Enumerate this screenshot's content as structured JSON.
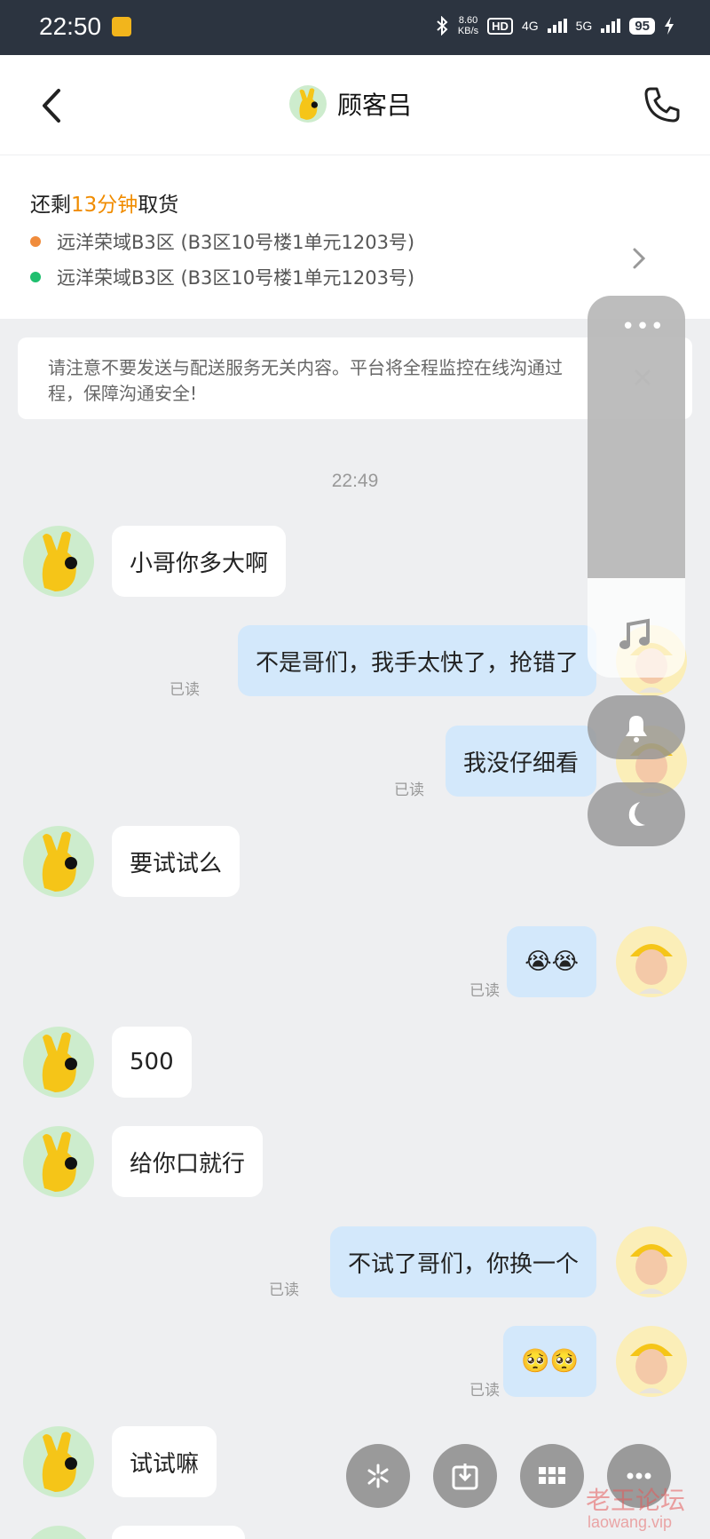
{
  "status_bar": {
    "time": "22:50",
    "net_speed_value": "8.60",
    "net_speed_unit": "KB/s",
    "hd_label": "HD",
    "sim1_label": "4G",
    "sim2_label": "5G",
    "battery": "95"
  },
  "header": {
    "title": "顾客吕"
  },
  "order": {
    "prefix": "还剩",
    "time_left": "13分钟",
    "suffix": "取货",
    "pickup_address": "远洋荣域B3区 (B3区10号楼1单元1203号)",
    "delivery_address": "远洋荣域B3区 (B3区10号楼1单元1203号)",
    "pickup_dot_color": "#f08c3c",
    "delivery_dot_color": "#1fbf6e"
  },
  "notice": {
    "text": "请注意不要发送与配送服务无关内容。平台将全程监控在线沟通过程，保障沟通安全!"
  },
  "chat": {
    "timestamp": "22:49",
    "read_label": "已读",
    "messages": [
      {
        "side": "left",
        "text": "小哥你多大啊"
      },
      {
        "side": "right",
        "text": "不是哥们，我手太快了，抢错了",
        "status": "已读"
      },
      {
        "side": "right",
        "text": "我没仔细看",
        "status": "已读"
      },
      {
        "side": "left",
        "text": "要试试么"
      },
      {
        "side": "right",
        "text": "😭😭",
        "status": "已读"
      },
      {
        "side": "left",
        "text": "500"
      },
      {
        "side": "left",
        "text": "给你口就行"
      },
      {
        "side": "right",
        "text": "不试了哥们，你换一个",
        "status": "已读"
      },
      {
        "side": "right",
        "text": "🥺🥺",
        "status": "已读"
      },
      {
        "side": "left",
        "text": "试试嘛"
      }
    ]
  },
  "floating_panel": {
    "more_icon": "more-dots-icon",
    "music_icon": "music-note-icon",
    "bell_icon": "bell-icon",
    "moon_icon": "moon-icon"
  },
  "bottom_actions": {
    "icons": [
      "sparkle-icon",
      "download-icon",
      "grid-icon",
      "more-icon"
    ]
  },
  "watermark": {
    "text": "老王论坛",
    "url": "laowang.vip"
  }
}
